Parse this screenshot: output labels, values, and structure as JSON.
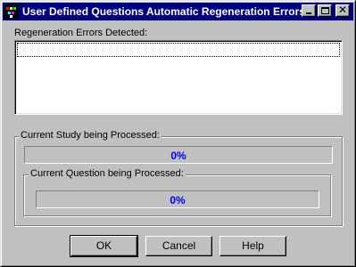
{
  "window": {
    "title": "User Defined Questions Automatic Regeneration Errors",
    "icon": "app-icon",
    "controls": {
      "minimize": "minimize-icon",
      "maximize": "maximize-icon",
      "close_glyph": "✕"
    }
  },
  "errors": {
    "label": "Regeneration Errors Detected:",
    "items": []
  },
  "study": {
    "label": "Current Study being Processed:",
    "progress": 0,
    "percent_text": "0%"
  },
  "question": {
    "label": "Current Question being Processed:",
    "progress": 0,
    "percent_text": "0%"
  },
  "buttons": {
    "ok": "OK",
    "cancel": "Cancel",
    "help": "Help"
  },
  "colors": {
    "titlebar": "#000080",
    "progress_text": "#0000ff",
    "face": "#c0c0c0"
  }
}
